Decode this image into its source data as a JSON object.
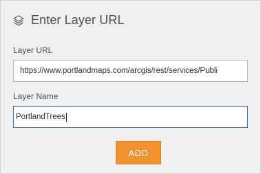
{
  "dialog": {
    "title": "Enter Layer URL",
    "icon": "layers-icon"
  },
  "layer_url": {
    "label": "Layer URL",
    "value": "https://www.portlandmaps.com/arcgis/rest/services/Publi"
  },
  "layer_name": {
    "label": "Layer Name",
    "value": "PortlandTrees"
  },
  "add_button": {
    "label": "ADD"
  },
  "colors": {
    "accent": "#f0932e",
    "focus_border": "#3f6fa1",
    "panel_bg": "#f0f0f0"
  }
}
